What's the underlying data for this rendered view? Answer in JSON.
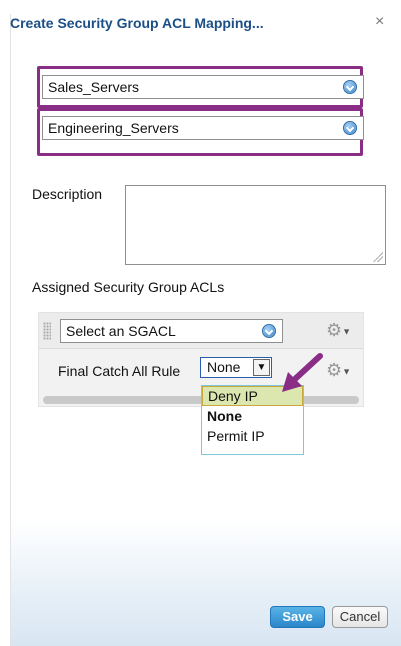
{
  "dialog": {
    "title": "Create Security Group ACL Mapping...",
    "close_glyph": "×"
  },
  "source_group": {
    "value": "Sales_Servers"
  },
  "destination_group": {
    "value": "Engineering_Servers"
  },
  "description": {
    "label": "Description",
    "value": ""
  },
  "acls": {
    "label": "Assigned Security Group ACLs",
    "sgacl_select": {
      "value": "Select an SGACL"
    },
    "final_rule": {
      "label": "Final Catch All Rule",
      "value": "None",
      "options": [
        "Deny IP",
        "None",
        "Permit IP"
      ],
      "hovered": "Deny IP",
      "selected": "None"
    }
  },
  "buttons": {
    "save": "Save",
    "cancel": "Cancel"
  },
  "colors": {
    "title": "#1b4f86",
    "highlight": "#8a2d86",
    "save": "#2a86c9",
    "hover_option": "#dce7b0"
  },
  "icons": [
    "close-icon",
    "chevron-down-icon",
    "gear-icon",
    "drag-handle-icon",
    "arrow-annotation-icon"
  ]
}
